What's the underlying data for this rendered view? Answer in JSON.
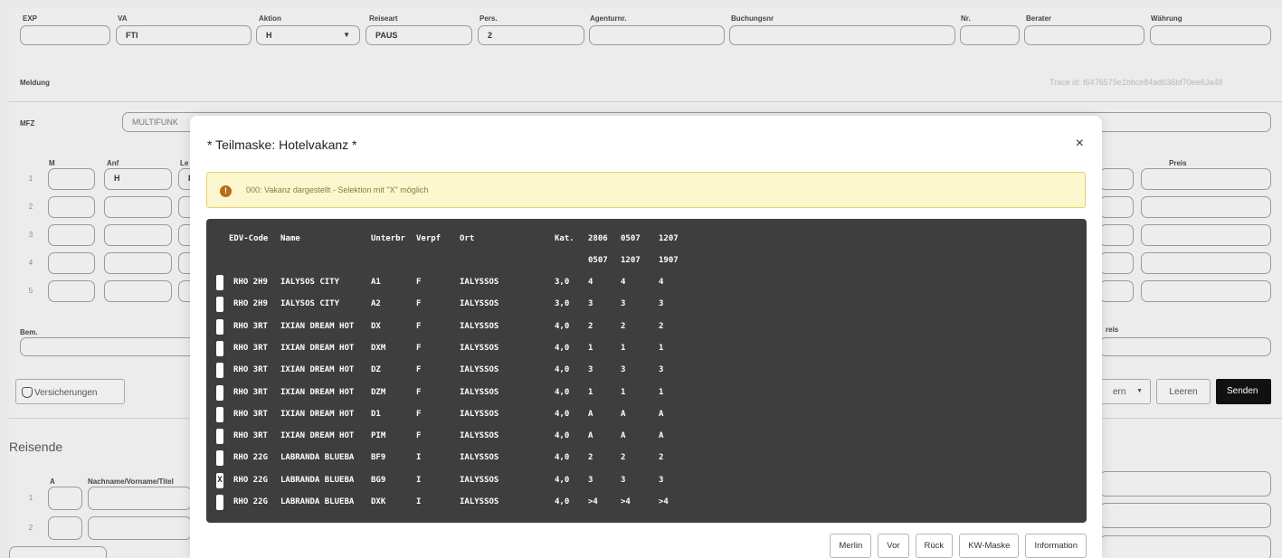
{
  "header": {
    "labels": [
      "EXP",
      "VA",
      "Aktion",
      "Reiseart",
      "Pers.",
      "Agenturnr.",
      "Buchungsnr",
      "Nr.",
      "Berater",
      "Währung"
    ],
    "values": {
      "va": "FTI",
      "aktion": "H",
      "reiseart": "PAUS",
      "pers": "2"
    }
  },
  "meldung": {
    "label": "Meldung",
    "trace": "Trace id: f6476579e1bbce84ad636bf70ee6Ja48"
  },
  "mfz": {
    "label": "MFZ",
    "value": "MULTIFUNK"
  },
  "grid": {
    "labels": {
      "m": "M",
      "anf": "Anf",
      "le": "Le",
      "preis": "Preis"
    },
    "anf_value": "H",
    "anf_value2": "I",
    "rows": [
      "1",
      "2",
      "3",
      "4",
      "5"
    ]
  },
  "bem": {
    "label": "Bem.",
    "preis_label": "reis"
  },
  "actions": {
    "versicherungen": "Versicherungen",
    "partial": "ern",
    "leeren": "Leeren",
    "senden": "Senden"
  },
  "reisende": {
    "title": "Reisende",
    "col_a": "A",
    "col_name": "Nachname/Vorname/Titel",
    "rows": [
      "1",
      "2"
    ]
  },
  "modal": {
    "title": "* Teilmaske: Hotelvakanz *",
    "close": "×",
    "alert_icon": "!",
    "alert_text": "000: Vakanz dargestellt - Selektion mit \"X\" möglich",
    "terminal": {
      "header1": [
        "EDV-Code",
        "Name",
        "Unterbr",
        "Verpf",
        "Ort",
        "Kat.",
        "2806",
        "0507",
        "1207"
      ],
      "header2": [
        "0507",
        "1207",
        "1907"
      ],
      "rows": [
        {
          "sel": "",
          "code": "RHO 2H9",
          "name": "IALYSOS CITY",
          "unterbr": "A1",
          "verpf": "F",
          "ort": "IALYSSOS",
          "kat": "3,0",
          "d1": "4",
          "d2": "4",
          "d3": "4"
        },
        {
          "sel": "",
          "code": "RHO 2H9",
          "name": "IALYSOS CITY",
          "unterbr": "A2",
          "verpf": "F",
          "ort": "IALYSSOS",
          "kat": "3,0",
          "d1": "3",
          "d2": "3",
          "d3": "3"
        },
        {
          "sel": "",
          "code": "RHO 3RT",
          "name": "IXIAN DREAM HOT",
          "unterbr": "DX",
          "verpf": "F",
          "ort": "IALYSSOS",
          "kat": "4,0",
          "d1": "2",
          "d2": "2",
          "d3": "2"
        },
        {
          "sel": "",
          "code": "RHO 3RT",
          "name": "IXIAN DREAM HOT",
          "unterbr": "DXM",
          "verpf": "F",
          "ort": "IALYSSOS",
          "kat": "4,0",
          "d1": "1",
          "d2": "1",
          "d3": "1"
        },
        {
          "sel": "",
          "code": "RHO 3RT",
          "name": "IXIAN DREAM HOT",
          "unterbr": "DZ",
          "verpf": "F",
          "ort": "IALYSSOS",
          "kat": "4,0",
          "d1": "3",
          "d2": "3",
          "d3": "3"
        },
        {
          "sel": "",
          "code": "RHO 3RT",
          "name": "IXIAN DREAM HOT",
          "unterbr": "DZM",
          "verpf": "F",
          "ort": "IALYSSOS",
          "kat": "4,0",
          "d1": "1",
          "d2": "1",
          "d3": "1"
        },
        {
          "sel": "",
          "code": "RHO 3RT",
          "name": "IXIAN DREAM HOT",
          "unterbr": "D1",
          "verpf": "F",
          "ort": "IALYSSOS",
          "kat": "4,0",
          "d1": "A",
          "d2": "A",
          "d3": "A"
        },
        {
          "sel": "",
          "code": "RHO 3RT",
          "name": "IXIAN DREAM HOT",
          "unterbr": "PIM",
          "verpf": "F",
          "ort": "IALYSSOS",
          "kat": "4,0",
          "d1": "A",
          "d2": "A",
          "d3": "A"
        },
        {
          "sel": "",
          "code": "RHO 22G",
          "name": "LABRANDA BLUEBA",
          "unterbr": "BF9",
          "verpf": "I",
          "ort": "IALYSSOS",
          "kat": "4,0",
          "d1": "2",
          "d2": "2",
          "d3": "2"
        },
        {
          "sel": "X",
          "code": "RHO 22G",
          "name": "LABRANDA BLUEBA",
          "unterbr": "BG9",
          "verpf": "I",
          "ort": "IALYSSOS",
          "kat": "4,0",
          "d1": "3",
          "d2": "3",
          "d3": "3"
        },
        {
          "sel": "",
          "code": "RHO 22G",
          "name": "LABRANDA BLUEBA",
          "unterbr": "DXK",
          "verpf": "I",
          "ort": "IALYSSOS",
          "kat": "4,0",
          "d1": ">4",
          "d2": ">4",
          "d3": ">4"
        }
      ]
    },
    "buttons": [
      "Merlin",
      "Vor",
      "Rück",
      "KW-Maske",
      "Information"
    ]
  },
  "colors": {
    "terminal_bg": "#3e3e3e",
    "alert_bg": "#fdf7cf",
    "alert_icon": "#b86d1b",
    "send_bg": "#111111"
  }
}
